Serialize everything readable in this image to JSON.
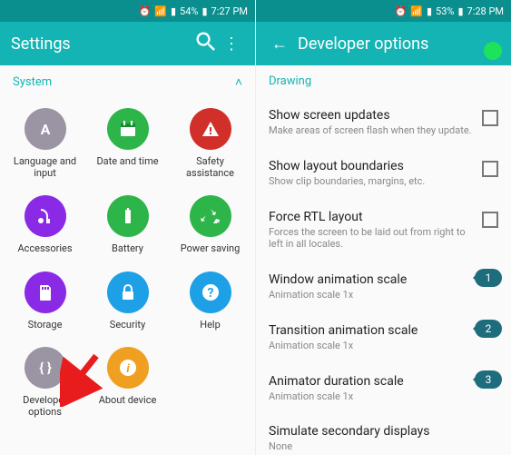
{
  "left": {
    "status": {
      "battery": "54%",
      "time": "7:27 PM"
    },
    "title": "Settings",
    "section": "System",
    "tiles": [
      {
        "label": "Language and input",
        "icon": "A",
        "color": "#9a94a3"
      },
      {
        "label": "Date and time",
        "icon": "cal",
        "color": "#2db54a"
      },
      {
        "label": "Safety assistance",
        "icon": "warn",
        "color": "#d1302a"
      },
      {
        "label": "Accessories",
        "icon": "head",
        "color": "#8a2ae6"
      },
      {
        "label": "Battery",
        "icon": "batt",
        "color": "#2db54a"
      },
      {
        "label": "Power saving",
        "icon": "recycle",
        "color": "#2db54a"
      },
      {
        "label": "Storage",
        "icon": "sd",
        "color": "#8a2ae6"
      },
      {
        "label": "Security",
        "icon": "lock",
        "color": "#1ea0e6"
      },
      {
        "label": "Help",
        "icon": "help",
        "color": "#1ea0e6"
      },
      {
        "label": "Developer options",
        "icon": "braces",
        "color": "#9a94a3"
      },
      {
        "label": "About device",
        "icon": "info",
        "color": "#f0a020"
      }
    ]
  },
  "right": {
    "status": {
      "battery": "53%",
      "time": "7:28 PM"
    },
    "title": "Developer options",
    "section": "Drawing",
    "items": [
      {
        "title": "Show screen updates",
        "sub": "Make areas of screen flash when they update.",
        "check": true
      },
      {
        "title": "Show layout boundaries",
        "sub": "Show clip boundaries, margins, etc.",
        "check": true
      },
      {
        "title": "Force RTL layout",
        "sub": "Forces the screen to be laid out from right to left in all locales.",
        "check": true
      },
      {
        "title": "Window animation scale",
        "sub": "Animation scale 1x",
        "badge": "1"
      },
      {
        "title": "Transition animation scale",
        "sub": "Animation scale 1x",
        "badge": "2"
      },
      {
        "title": "Animator duration scale",
        "sub": "Animation scale 1x",
        "badge": "3"
      },
      {
        "title": "Simulate secondary displays",
        "sub": "None"
      }
    ]
  }
}
